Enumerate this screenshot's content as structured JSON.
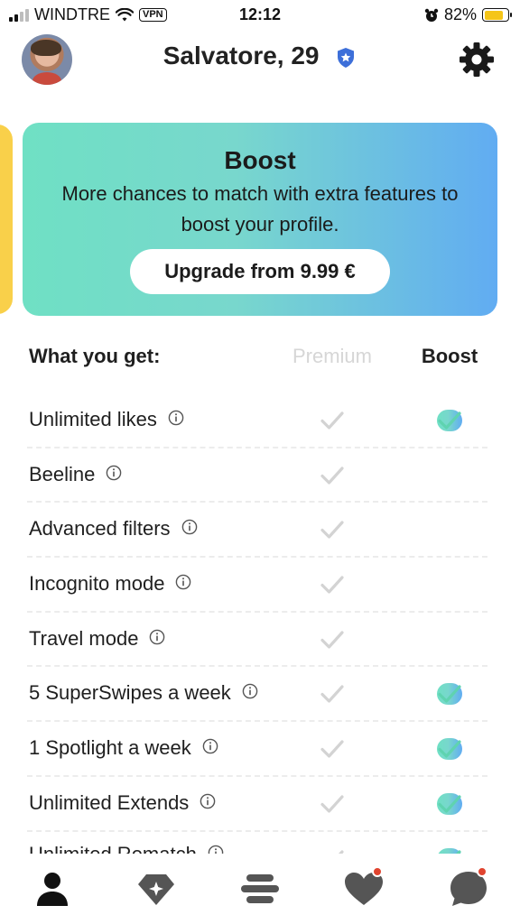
{
  "status_bar": {
    "carrier": "WINDTRE",
    "vpn": "VPN",
    "time": "12:12",
    "battery": "82%",
    "battery_level": 0.82
  },
  "header": {
    "title": "Salvatore, 29"
  },
  "boost_card": {
    "title": "Boost",
    "description": "More chances to match with extra features to boost your profile.",
    "button": "Upgrade from 9.99 €"
  },
  "table": {
    "heading": "What you get:",
    "col_premium": "Premium",
    "col_boost": "Boost",
    "rows": [
      {
        "label": "Unlimited likes",
        "premium": true,
        "boost": true
      },
      {
        "label": "Beeline",
        "premium": true,
        "boost": false
      },
      {
        "label": "Advanced filters",
        "premium": true,
        "boost": false
      },
      {
        "label": "Incognito mode",
        "premium": true,
        "boost": false
      },
      {
        "label": "Travel mode",
        "premium": true,
        "boost": false
      },
      {
        "label": "5 SuperSwipes a week",
        "premium": true,
        "boost": true
      },
      {
        "label": "1 Spotlight a week",
        "premium": true,
        "boost": true
      },
      {
        "label": "Unlimited Extends",
        "premium": true,
        "boost": true
      },
      {
        "label": "Unlimited Rematch",
        "premium": true,
        "boost": true
      }
    ]
  },
  "colors": {
    "boost_check": "#5fd3b0",
    "premium_check": "#d3d3d3",
    "gradient_start": "#6fe0c4",
    "gradient_end": "#61acf2",
    "notification_dot": "#e0442f"
  },
  "nav": [
    "profile-icon",
    "premium-diamond-icon",
    "encounters-icon",
    "liked-you-icon",
    "chats-icon"
  ]
}
